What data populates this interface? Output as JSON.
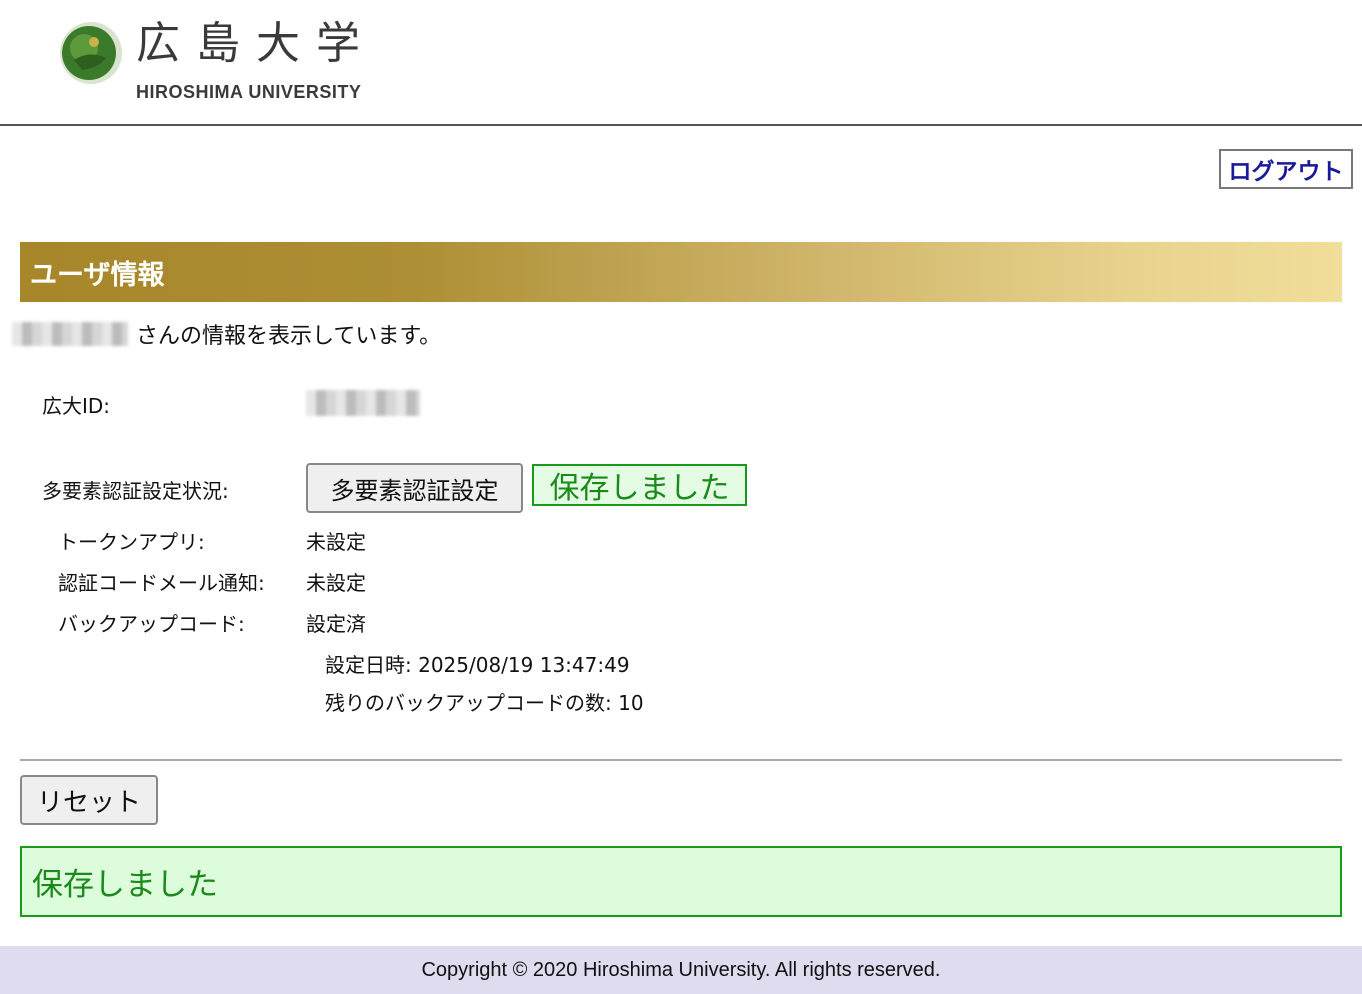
{
  "header": {
    "logo_kanji": "広島大学",
    "logo_english": "HIROSHIMA UNIVERSITY"
  },
  "logout_label": "ログアウト",
  "section_title": "ユーザ情報",
  "user_line_suffix": "さんの情報を表示しています。",
  "fields": {
    "hirodai_id_label": "広大ID:",
    "mfa_status_label": "多要素認証設定状況:",
    "mfa_button_label": "多要素認証設定",
    "saved_inline": "保存しました",
    "token_app_label": "トークンアプリ:",
    "token_app_value": "未設定",
    "email_code_label": "認証コードメール通知:",
    "email_code_value": "未設定",
    "backup_code_label": "バックアップコード:",
    "backup_code_value": "設定済",
    "set_datetime": "設定日時: 2025/08/19 13:47:49",
    "remaining_codes": "残りのバックアップコードの数: 10"
  },
  "reset_label": "リセット",
  "saved_message": "保存しました",
  "footer": "Copyright © 2020 Hiroshima University. All rights reserved.",
  "colors": {
    "link": "#1a1a99",
    "success_text": "#1a8a1a",
    "success_bg": "#dcfcdc",
    "section_gold": "#a8862a",
    "footer_bg": "#dedcee"
  }
}
